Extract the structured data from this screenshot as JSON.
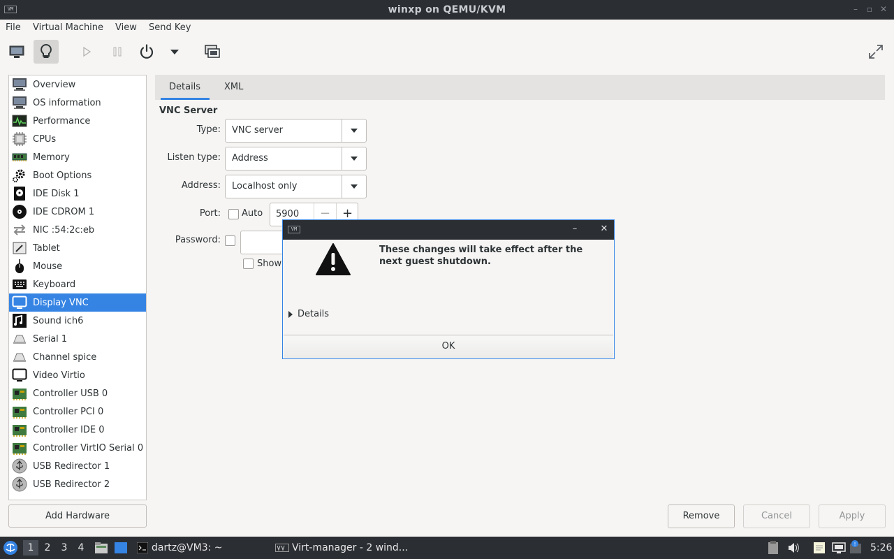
{
  "window": {
    "title": "winxp on QEMU/KVM",
    "logo": "VM"
  },
  "menu": [
    "File",
    "Virtual Machine",
    "View",
    "Send Key"
  ],
  "toolbar": {
    "buttons": [
      "monitor-icon",
      "lightbulb-icon",
      "play-icon",
      "pause-icon",
      "power-icon",
      "dropdown-icon",
      "screenshot-icon",
      "fullscreen-icon"
    ]
  },
  "sidebar": {
    "items": [
      {
        "label": "Overview",
        "icon": "monitor-icon"
      },
      {
        "label": "OS information",
        "icon": "monitor-icon"
      },
      {
        "label": "Performance",
        "icon": "performance-icon"
      },
      {
        "label": "CPUs",
        "icon": "cpu-icon"
      },
      {
        "label": "Memory",
        "icon": "memory-icon"
      },
      {
        "label": "Boot Options",
        "icon": "gear-icon"
      },
      {
        "label": "IDE Disk 1",
        "icon": "disk-icon"
      },
      {
        "label": "IDE CDROM 1",
        "icon": "cdrom-icon"
      },
      {
        "label": "NIC :54:2c:eb",
        "icon": "network-icon"
      },
      {
        "label": "Tablet",
        "icon": "tablet-icon"
      },
      {
        "label": "Mouse",
        "icon": "mouse-icon"
      },
      {
        "label": "Keyboard",
        "icon": "keyboard-icon"
      },
      {
        "label": "Display VNC",
        "icon": "display-icon"
      },
      {
        "label": "Sound ich6",
        "icon": "sound-icon"
      },
      {
        "label": "Serial 1",
        "icon": "serial-icon"
      },
      {
        "label": "Channel spice",
        "icon": "channel-icon"
      },
      {
        "label": "Video Virtio",
        "icon": "video-icon"
      },
      {
        "label": "Controller USB 0",
        "icon": "controller-icon"
      },
      {
        "label": "Controller PCI 0",
        "icon": "controller-icon"
      },
      {
        "label": "Controller IDE 0",
        "icon": "controller-icon"
      },
      {
        "label": "Controller VirtIO Serial 0",
        "icon": "controller-icon"
      },
      {
        "label": "USB Redirector 1",
        "icon": "usb-icon"
      },
      {
        "label": "USB Redirector 2",
        "icon": "usb-icon"
      }
    ],
    "selected_index": 12,
    "add_hardware": "Add Hardware"
  },
  "tabs": [
    "Details",
    "XML"
  ],
  "vnc": {
    "section_title": "VNC Server",
    "type_label": "Type:",
    "type_value": "VNC server",
    "listen_label": "Listen type:",
    "listen_value": "Address",
    "address_label": "Address:",
    "address_value": "Localhost only",
    "port_label": "Port:",
    "auto_label": "Auto",
    "port_value": "5900",
    "minus": "−",
    "plus": "+",
    "password_label": "Password:",
    "show_label": "Show"
  },
  "buttons": {
    "remove": "Remove",
    "cancel": "Cancel",
    "apply": "Apply"
  },
  "dialog": {
    "logo": "VM",
    "minimize": "–",
    "close": "✕",
    "message": "These changes will take effect after the next guest shutdown.",
    "details": "Details",
    "ok": "OK"
  },
  "taskbar": {
    "workspaces": [
      "1",
      "2",
      "3",
      "4"
    ],
    "terminal": "dartz@VM3: ~",
    "virtmanager": "Virt-manager - 2 wind...",
    "clock": "5:26",
    "accent": "#3584e4"
  }
}
